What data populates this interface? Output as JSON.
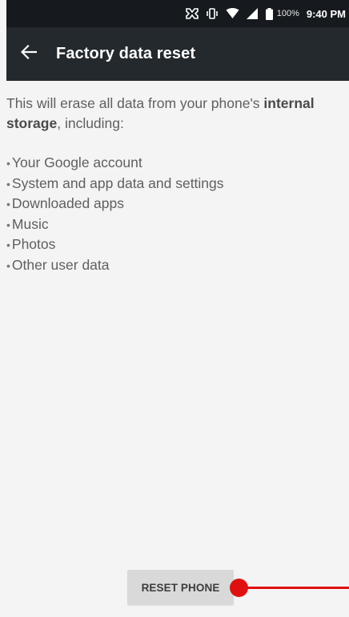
{
  "status_bar": {
    "icons": [
      "nfc-icon",
      "vibrate-icon",
      "wifi-icon",
      "signal-icon",
      "battery-icon"
    ],
    "battery_percent": "100%",
    "time": "9:40 PM"
  },
  "toolbar": {
    "back_icon": "arrow-left-icon",
    "title": "Factory data reset"
  },
  "content": {
    "intro_prefix": "This will erase all data from your phone's ",
    "intro_bold": "internal storage",
    "intro_suffix": ", including:",
    "items": [
      "Your Google account",
      "System and app data and settings",
      "Downloaded apps",
      "Music",
      "Photos",
      "Other user data"
    ]
  },
  "reset_button": {
    "label": "RESET PHONE"
  },
  "colors": {
    "status_bar_bg": "#161a1e",
    "toolbar_bg": "#24292d",
    "page_bg": "#f4f4f4",
    "button_bg": "#d9d9d9",
    "annotation_red": "#e01010"
  }
}
